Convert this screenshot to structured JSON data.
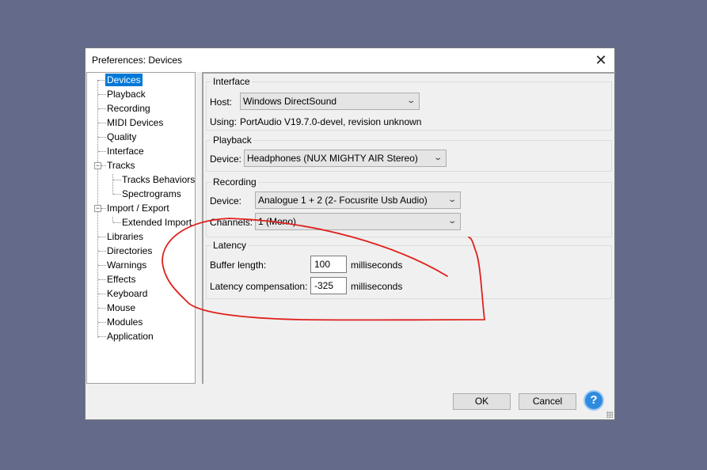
{
  "window": {
    "title": "Preferences: Devices",
    "close_icon": "close-icon"
  },
  "tree": {
    "items": [
      {
        "label": "Devices",
        "selected": true
      },
      {
        "label": "Playback"
      },
      {
        "label": "Recording"
      },
      {
        "label": "MIDI Devices"
      },
      {
        "label": "Quality"
      },
      {
        "label": "Interface"
      },
      {
        "label": "Tracks",
        "expander": "−"
      },
      {
        "label": "Tracks Behaviors"
      },
      {
        "label": "Spectrograms"
      },
      {
        "label": "Import / Export",
        "expander": "−"
      },
      {
        "label": "Extended Import"
      },
      {
        "label": "Libraries"
      },
      {
        "label": "Directories"
      },
      {
        "label": "Warnings"
      },
      {
        "label": "Effects"
      },
      {
        "label": "Keyboard"
      },
      {
        "label": "Mouse"
      },
      {
        "label": "Modules"
      },
      {
        "label": "Application"
      }
    ]
  },
  "interface": {
    "group_label": "Interface",
    "host_label": "Host:",
    "host_value": "Windows DirectSound",
    "using_label": "Using:",
    "using_value": "PortAudio V19.7.0-devel, revision unknown"
  },
  "playback": {
    "group_label": "Playback",
    "device_label": "Device:",
    "device_value": "Headphones (NUX MIGHTY AIR Stereo)"
  },
  "recording": {
    "group_label": "Recording",
    "device_label": "Device:",
    "device_value": "Analogue 1 + 2 (2- Focusrite Usb Audio)",
    "channels_label": "Channels:",
    "channels_value": "1 (Mono)"
  },
  "latency": {
    "group_label": "Latency",
    "buffer_label": "Buffer length:",
    "buffer_value": "100",
    "buffer_unit": "milliseconds",
    "comp_label": "Latency compensation:",
    "comp_value": "-325",
    "comp_unit": "milliseconds"
  },
  "footer": {
    "ok_label": "OK",
    "cancel_label": "Cancel",
    "help_label": "?"
  },
  "colors": {
    "selection": "#0078d7",
    "annotation": "#e0201c",
    "background": "#646a8a"
  }
}
